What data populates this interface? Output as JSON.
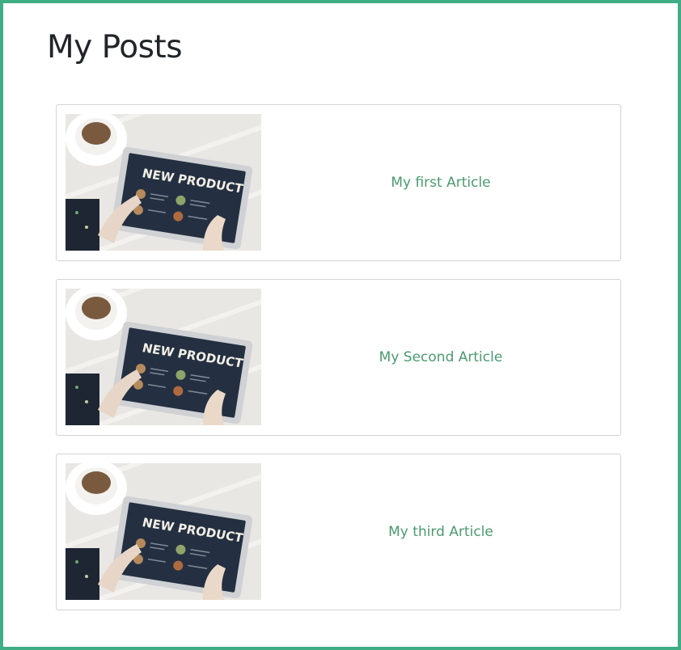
{
  "page": {
    "title": "My Posts",
    "accent_color": "#3fae84",
    "link_color": "#4a9a6f"
  },
  "posts": [
    {
      "title": "My first Article",
      "thumbnail": {
        "label": "NEW PRODUCT",
        "icon": "tablet-coffee-photo"
      }
    },
    {
      "title": "My Second Article",
      "thumbnail": {
        "label": "NEW PRODUCT",
        "icon": "tablet-coffee-photo"
      }
    },
    {
      "title": "My third Article",
      "thumbnail": {
        "label": "NEW PRODUCT",
        "icon": "tablet-coffee-photo"
      }
    }
  ]
}
